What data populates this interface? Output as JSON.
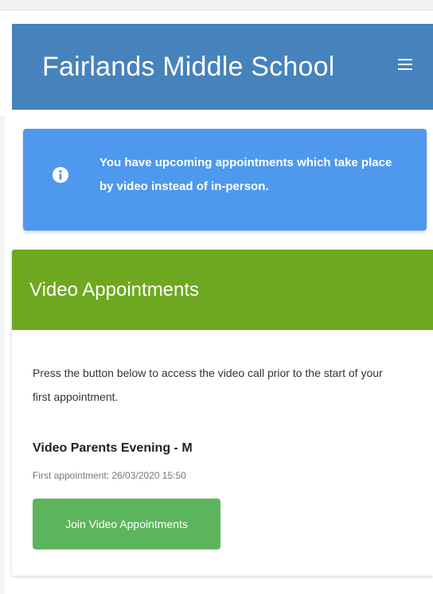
{
  "header": {
    "title": "Fairlands Middle School",
    "menu_icon": "hamburger-menu-icon",
    "background_color": "#4682bc"
  },
  "alert": {
    "icon": "info-circle-icon",
    "message": "You have upcoming appointments which take place by video instead of in-person.",
    "background_color": "#4e98ee"
  },
  "video_card": {
    "title": "Video Appointments",
    "description": "Press the button below to access the video call prior to the start of your first appointment.",
    "event_name": "Video Parents Evening - M",
    "first_appointment": "First appointment: 26/03/2020 15:50",
    "join_label": "Join Video Appointments",
    "header_color": "#6ea820",
    "button_color": "#5cb55c"
  }
}
